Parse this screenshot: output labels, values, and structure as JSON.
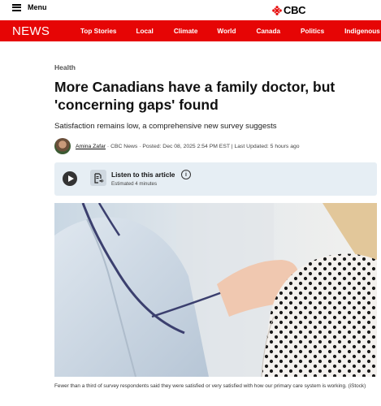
{
  "header": {
    "menu_label": "Menu",
    "logo_text": "CBC"
  },
  "nav": {
    "brand": "NEWS",
    "items": [
      "Top Stories",
      "Local",
      "Climate",
      "World",
      "Canada",
      "Politics",
      "Indigenous"
    ]
  },
  "article": {
    "category": "Health",
    "headline_line1": "More Canadians have a family doctor, but",
    "headline_line2": "'concerning gaps' found",
    "deck": "Satisfaction remains low, a comprehensive new survey suggests",
    "author": "Amina Zafar",
    "byline_rest": " · CBC News · Posted: Dec 08, 2025 2:54 PM EST | Last Updated: 5 hours ago",
    "listen": {
      "title": "Listen to this article",
      "estimate": "Estimated 4 minutes"
    },
    "caption": "Fewer than a third of survey respondents said they were satisfied or very satisfied with how our primary care system is working. (iStock)"
  },
  "colors": {
    "brand_red": "#e60505",
    "listen_bg": "#e6eef4"
  },
  "icons": {
    "menu": "hamburger-icon",
    "logo": "cbc-gem-icon",
    "play": "play-icon",
    "audio": "audio-document-icon",
    "info": "info-icon"
  }
}
